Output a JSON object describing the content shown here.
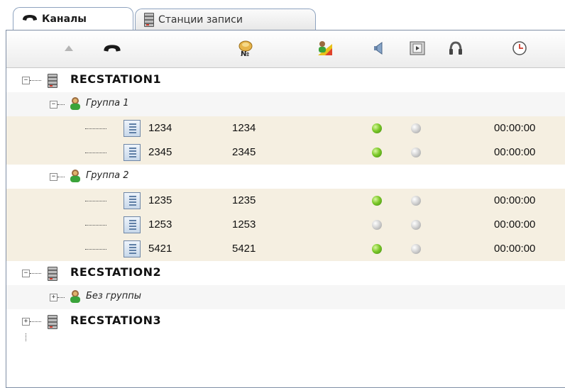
{
  "tabs": [
    {
      "label": "Каналы",
      "icon": "handset-icon",
      "active": true
    },
    {
      "label": "Станции записи",
      "icon": "server-icon",
      "active": false
    }
  ],
  "header": {
    "columns": [
      {
        "icon": "sort-up-icon"
      },
      {
        "icon": "handset-icon"
      },
      {
        "icon": "number-badge-icon"
      },
      {
        "icon": "user-level-icon"
      },
      {
        "icon": "speaker-icon"
      },
      {
        "icon": "film-icon"
      },
      {
        "icon": "headphones-icon"
      },
      {
        "icon": "clock-icon"
      }
    ]
  },
  "tree": {
    "stations": [
      {
        "name": "RECSTATION1",
        "expanded": true,
        "groups": [
          {
            "name": "Группа 1",
            "expanded": true,
            "channels": [
              {
                "name": "1234",
                "number": "1234",
                "status": "green",
                "listen": "grey",
                "time": "00:00:00"
              },
              {
                "name": "2345",
                "number": "2345",
                "status": "green",
                "listen": "grey",
                "time": "00:00:00"
              }
            ]
          },
          {
            "name": "Группа 2",
            "expanded": true,
            "channels": [
              {
                "name": "1235",
                "number": "1235",
                "status": "green",
                "listen": "grey",
                "time": "00:00:00"
              },
              {
                "name": "1253",
                "number": "1253",
                "status": "grey",
                "listen": "grey",
                "time": "00:00:00"
              },
              {
                "name": "5421",
                "number": "5421",
                "status": "green",
                "listen": "grey",
                "time": "00:00:00"
              }
            ]
          }
        ]
      },
      {
        "name": "RECSTATION2",
        "expanded": true,
        "groups": [
          {
            "name": "Без группы",
            "expanded": false,
            "channels": []
          }
        ]
      },
      {
        "name": "RECSTATION3",
        "expanded": false,
        "groups": []
      }
    ]
  },
  "colors": {
    "row_highlight": "#f5efe1",
    "status_green": "#7dc92a",
    "status_grey": "#cfcfcf",
    "tab_border": "#8ea3bf"
  }
}
